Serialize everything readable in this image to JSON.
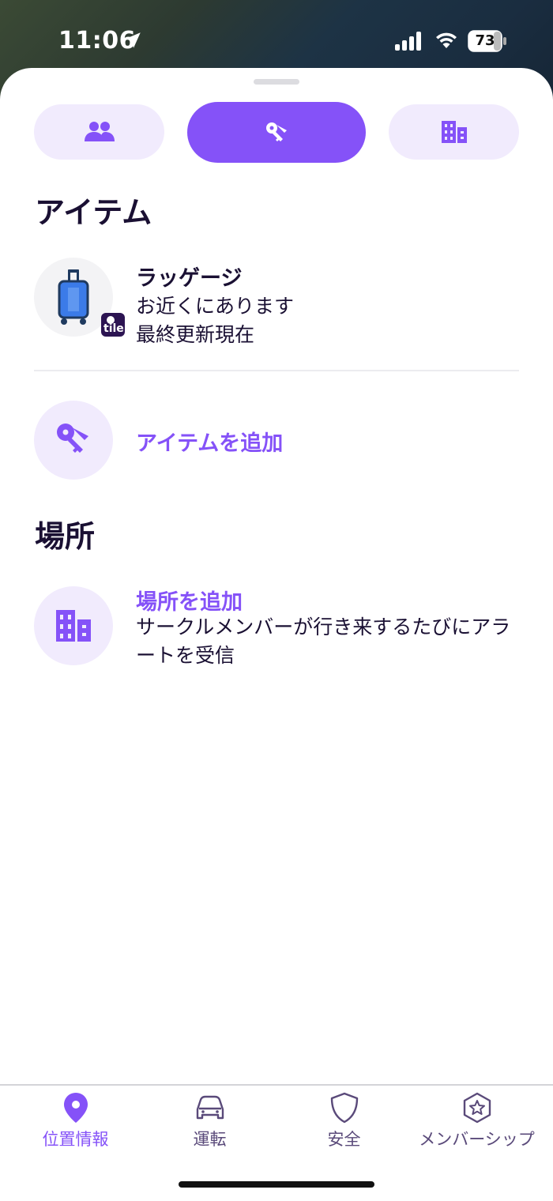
{
  "status": {
    "time": "11:06",
    "battery": "73"
  },
  "segments": [
    {
      "name": "people",
      "icon": "people-icon",
      "active": false
    },
    {
      "name": "items",
      "icon": "keys-icon",
      "active": true
    },
    {
      "name": "places",
      "icon": "building-icon",
      "active": false
    }
  ],
  "items_section": {
    "title": "アイテム",
    "items": [
      {
        "name": "ラッゲージ",
        "status": "お近くにあります",
        "updated": "最終更新現在",
        "icon": "luggage-icon",
        "badge": "tile"
      }
    ],
    "add_label": "アイテムを追加"
  },
  "places_section": {
    "title": "場所",
    "add_title": "場所を追加",
    "add_description": "サークルメンバーが行き来するたびにアラートを受信"
  },
  "tabbar": [
    {
      "label": "位置情報",
      "icon": "location-pin-icon",
      "active": true
    },
    {
      "label": "運転",
      "icon": "car-icon",
      "active": false
    },
    {
      "label": "安全",
      "icon": "shield-icon",
      "active": false
    },
    {
      "label": "メンバーシップ",
      "icon": "star-badge-icon",
      "active": false
    }
  ],
  "colors": {
    "accent": "#8552f8",
    "accent_light": "#f1ebfd",
    "text": "#1a1033"
  }
}
